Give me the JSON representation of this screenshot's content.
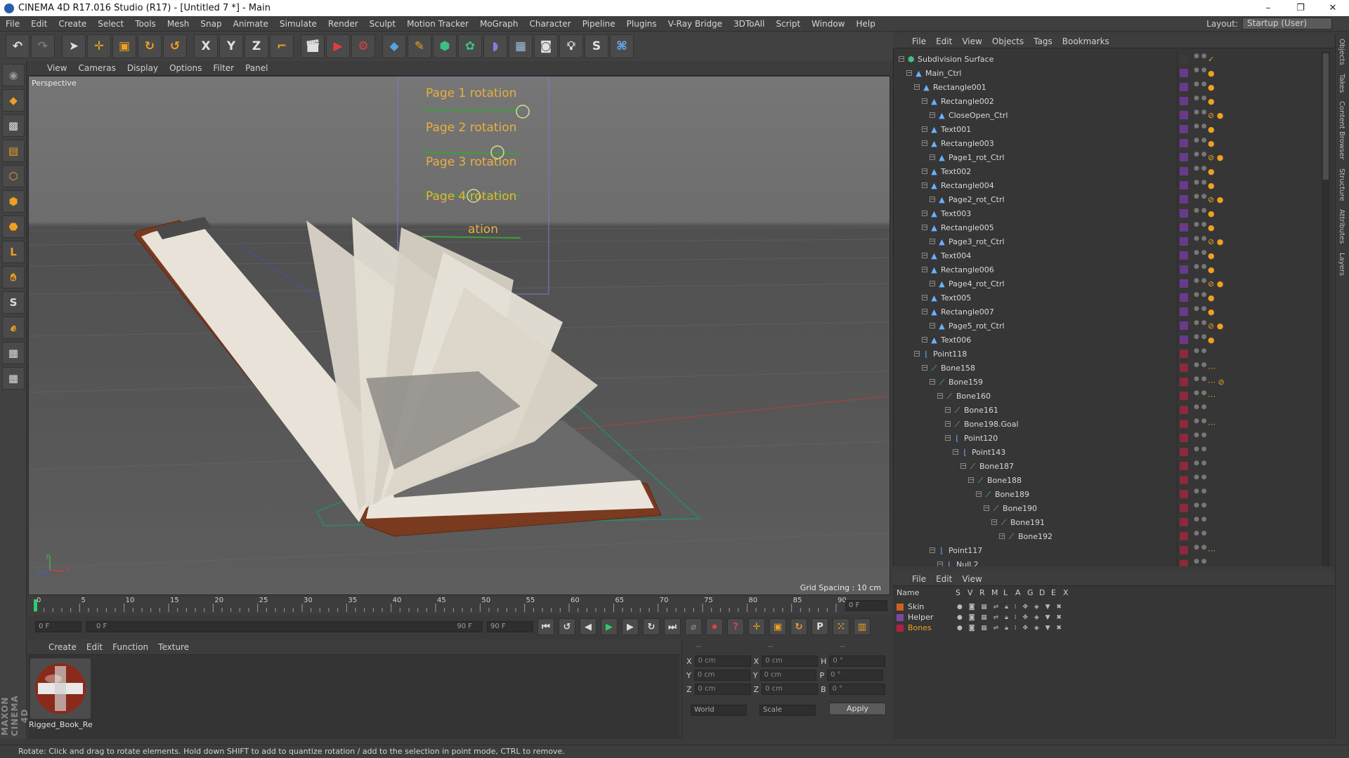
{
  "titlebar": {
    "title": "CINEMA 4D R17.016 Studio (R17) - [Untitled 7 *] - Main",
    "minimize": "–",
    "restore": "❐",
    "close": "✕"
  },
  "menubar": {
    "items": [
      "File",
      "Edit",
      "Create",
      "Select",
      "Tools",
      "Mesh",
      "Snap",
      "Animate",
      "Simulate",
      "Render",
      "Sculpt",
      "Motion Tracker",
      "MoGraph",
      "Character",
      "Pipeline",
      "Plugins",
      "V-Ray Bridge",
      "3DToAll",
      "Script",
      "Window",
      "Help"
    ],
    "layout_label": "Layout:",
    "layout_value": "Startup (User)"
  },
  "toolbar": {
    "icons": [
      "undo-icon",
      "redo-icon",
      "live-selection-icon",
      "move-icon",
      "scale-icon",
      "rotate-icon",
      "recent-tool-icon",
      "x-axis-icon",
      "y-axis-icon",
      "z-axis-icon",
      "coordinate-system-icon",
      "render-view-icon",
      "render-picture-viewer-icon",
      "edit-render-settings-icon",
      "cube-icon",
      "pen-icon",
      "subdivision-icon",
      "array-icon",
      "deformer-icon",
      "floor-icon",
      "camera-icon",
      "light-icon",
      "plugin-icon",
      "python-icon"
    ],
    "axis_labels": {
      "x": "X",
      "y": "Y",
      "z": "Z"
    }
  },
  "viewport": {
    "menu": [
      "View",
      "Cameras",
      "Display",
      "Options",
      "Filter",
      "Panel"
    ],
    "label": "Perspective",
    "grid_spacing": "Grid Spacing : 10 cm",
    "rig_labels": [
      "Page 1 rotation",
      "Page 2 rotation",
      "Page 3 rotation",
      "Page 4 rotation",
      "ation"
    ],
    "axis": {
      "y": "y",
      "x": "x",
      "z": "z"
    }
  },
  "timeline": {
    "ticks": [
      "0",
      "5",
      "10",
      "15",
      "20",
      "25",
      "30",
      "35",
      "40",
      "45",
      "50",
      "55",
      "60",
      "65",
      "70",
      "75",
      "80",
      "85",
      "90"
    ],
    "current_frame": "0 F",
    "start_field": "0 F",
    "range_start": "0 F",
    "range_end": "90 F",
    "end_field": "90 F"
  },
  "material_manager": {
    "menu": [
      "Create",
      "Edit",
      "Function",
      "Texture"
    ],
    "material_name": "Rigged_Book_Re"
  },
  "coordinates": {
    "headers": [
      "--",
      "--",
      "--"
    ],
    "rows": [
      {
        "l1": "X",
        "v1": "0 cm",
        "l2": "X",
        "v2": "0 cm",
        "l3": "H",
        "v3": "0 °"
      },
      {
        "l1": "Y",
        "v1": "0 cm",
        "l2": "Y",
        "v2": "0 cm",
        "l3": "P",
        "v3": "0 °"
      },
      {
        "l1": "Z",
        "v1": "0 cm",
        "l2": "Z",
        "v2": "0 cm",
        "l3": "B",
        "v3": "0 °"
      }
    ],
    "mode_world": "World",
    "mode_scale": "Scale",
    "apply": "Apply"
  },
  "object_manager": {
    "menu": [
      "File",
      "Edit",
      "View",
      "Objects",
      "Tags",
      "Bookmarks"
    ],
    "objects": [
      {
        "name": "Subdivision Surface",
        "indent": 0,
        "layer": "#3a3a3a",
        "tags": "✓"
      },
      {
        "name": "Main_Ctrl",
        "indent": 1,
        "layer": "#6a3a8a",
        "tags": "●"
      },
      {
        "name": "Rectangle001",
        "indent": 2,
        "layer": "#6a3a8a",
        "tags": "●"
      },
      {
        "name": "Rectangle002",
        "indent": 3,
        "layer": "#6a3a8a",
        "tags": "●"
      },
      {
        "name": "CloseOpen_Ctrl",
        "indent": 4,
        "layer": "#6a3a8a",
        "tags": "⊘ ●"
      },
      {
        "name": "Text001",
        "indent": 3,
        "layer": "#6a3a8a",
        "tags": "●"
      },
      {
        "name": "Rectangle003",
        "indent": 3,
        "layer": "#6a3a8a",
        "tags": "●"
      },
      {
        "name": "Page1_rot_Ctrl",
        "indent": 4,
        "layer": "#6a3a8a",
        "tags": "⊘ ●"
      },
      {
        "name": "Text002",
        "indent": 3,
        "layer": "#6a3a8a",
        "tags": "●"
      },
      {
        "name": "Rectangle004",
        "indent": 3,
        "layer": "#6a3a8a",
        "tags": "●"
      },
      {
        "name": "Page2_rot_Ctrl",
        "indent": 4,
        "layer": "#6a3a8a",
        "tags": "⊘ ●"
      },
      {
        "name": "Text003",
        "indent": 3,
        "layer": "#6a3a8a",
        "tags": "●"
      },
      {
        "name": "Rectangle005",
        "indent": 3,
        "layer": "#6a3a8a",
        "tags": "●"
      },
      {
        "name": "Page3_rot_Ctrl",
        "indent": 4,
        "layer": "#6a3a8a",
        "tags": "⊘ ●"
      },
      {
        "name": "Text004",
        "indent": 3,
        "layer": "#6a3a8a",
        "tags": "●"
      },
      {
        "name": "Rectangle006",
        "indent": 3,
        "layer": "#6a3a8a",
        "tags": "●"
      },
      {
        "name": "Page4_rot_Ctrl",
        "indent": 4,
        "layer": "#6a3a8a",
        "tags": "⊘ ●"
      },
      {
        "name": "Text005",
        "indent": 3,
        "layer": "#6a3a8a",
        "tags": "●"
      },
      {
        "name": "Rectangle007",
        "indent": 3,
        "layer": "#6a3a8a",
        "tags": "●"
      },
      {
        "name": "Page5_rot_Ctrl",
        "indent": 4,
        "layer": "#6a3a8a",
        "tags": "⊘ ●"
      },
      {
        "name": "Text006",
        "indent": 3,
        "layer": "#6a3a8a",
        "tags": "●"
      },
      {
        "name": "Point118",
        "indent": 2,
        "layer": "#8a2a3a",
        "tags": ""
      },
      {
        "name": "Bone158",
        "indent": 3,
        "layer": "#8a2a3a",
        "tags": "⋯"
      },
      {
        "name": "Bone159",
        "indent": 4,
        "layer": "#8a2a3a",
        "tags": "⋯ ⊘"
      },
      {
        "name": "Bone160",
        "indent": 5,
        "layer": "#8a2a3a",
        "tags": "⋯"
      },
      {
        "name": "Bone161",
        "indent": 6,
        "layer": "#8a2a3a",
        "tags": ""
      },
      {
        "name": "Bone198.Goal",
        "indent": 6,
        "layer": "#8a2a3a",
        "tags": "⋯"
      },
      {
        "name": "Point120",
        "indent": 6,
        "layer": "#8a2a3a",
        "tags": ""
      },
      {
        "name": "Point143",
        "indent": 7,
        "layer": "#8a2a3a",
        "tags": ""
      },
      {
        "name": "Bone187",
        "indent": 8,
        "layer": "#8a2a3a",
        "tags": ""
      },
      {
        "name": "Bone188",
        "indent": 9,
        "layer": "#8a2a3a",
        "tags": ""
      },
      {
        "name": "Bone189",
        "indent": 10,
        "layer": "#8a2a3a",
        "tags": ""
      },
      {
        "name": "Bone190",
        "indent": 11,
        "layer": "#8a2a3a",
        "tags": ""
      },
      {
        "name": "Bone191",
        "indent": 12,
        "layer": "#8a2a3a",
        "tags": ""
      },
      {
        "name": "Bone192",
        "indent": 13,
        "layer": "#8a2a3a",
        "tags": ""
      },
      {
        "name": "Point117",
        "indent": 4,
        "layer": "#8a2a3a",
        "tags": "⋯"
      },
      {
        "name": "Null.2",
        "indent": 5,
        "layer": "#8a2a3a",
        "tags": ""
      }
    ]
  },
  "layer_manager": {
    "menu": [
      "File",
      "Edit",
      "View"
    ],
    "columns": [
      "Name",
      "S",
      "V",
      "R",
      "M",
      "L",
      "A",
      "G",
      "D",
      "E",
      "X"
    ],
    "layers": [
      {
        "name": "Skin",
        "color": "#d06020"
      },
      {
        "name": "Helper",
        "color": "#7a4aa0"
      },
      {
        "name": "Bones",
        "color": "#b02040"
      }
    ]
  },
  "right_tabs": [
    "Objects",
    "Takes",
    "Content Browser",
    "Structure",
    "Attributes",
    "Layers"
  ],
  "statusbar": {
    "text": "Rotate: Click and drag to rotate elements. Hold down SHIFT to add to quantize rotation / add to the selection in point mode, CTRL to remove."
  },
  "branding": {
    "maxon": "MAXON CINEMA 4D"
  }
}
